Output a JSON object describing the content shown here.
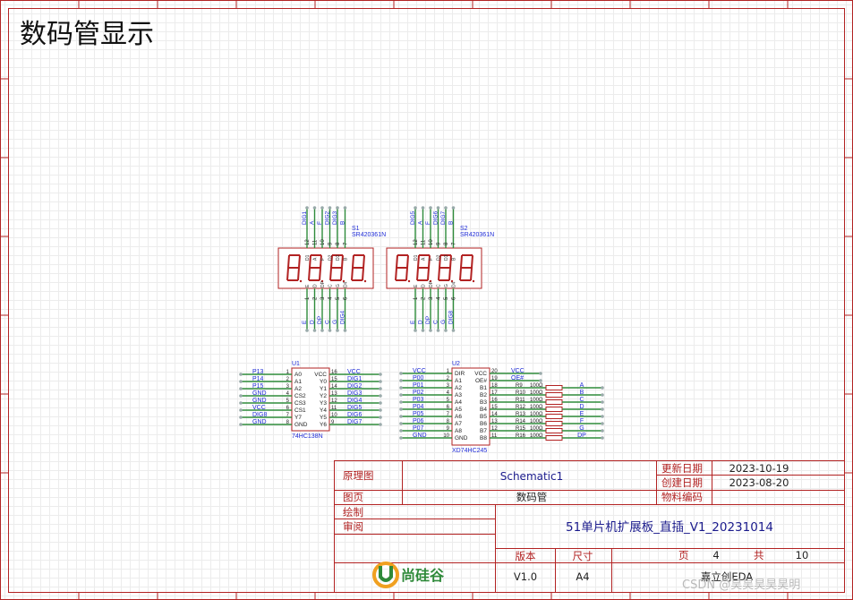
{
  "sheet": {
    "title": "数码管显示",
    "accent": "#b22222",
    "wire_color": "#2e8b3a",
    "text_color": "#1e2bd6"
  },
  "displays": [
    {
      "ref": "S1",
      "part": "SR420361N",
      "top_pins": [
        {
          "num": "12",
          "net": "DIG1",
          "inner": "D1"
        },
        {
          "num": "11",
          "net": "A",
          "inner": "A"
        },
        {
          "num": "10",
          "net": "F",
          "inner": "F"
        },
        {
          "num": "9",
          "net": "DIG2",
          "inner": "D2"
        },
        {
          "num": "8",
          "net": "DIG3",
          "inner": "D3"
        },
        {
          "num": "7",
          "net": "B",
          "inner": "B"
        }
      ],
      "bottom_pins": [
        {
          "num": "1",
          "net": "E",
          "inner": "E"
        },
        {
          "num": "2",
          "net": "D",
          "inner": "D"
        },
        {
          "num": "3",
          "net": "DP",
          "inner": "DP"
        },
        {
          "num": "4",
          "net": "C",
          "inner": "C"
        },
        {
          "num": "5",
          "net": "G",
          "inner": "G"
        },
        {
          "num": "6",
          "net": "DIG4",
          "inner": "D4"
        }
      ]
    },
    {
      "ref": "S2",
      "part": "SR420361N",
      "top_pins": [
        {
          "num": "12",
          "net": "DIG5",
          "inner": "D1"
        },
        {
          "num": "11",
          "net": "A",
          "inner": "A"
        },
        {
          "num": "10",
          "net": "F",
          "inner": "F"
        },
        {
          "num": "9",
          "net": "DIG6",
          "inner": "D2"
        },
        {
          "num": "8",
          "net": "DIG7",
          "inner": "D3"
        },
        {
          "num": "7",
          "net": "B",
          "inner": "B"
        }
      ],
      "bottom_pins": [
        {
          "num": "1",
          "net": "E",
          "inner": "E"
        },
        {
          "num": "2",
          "net": "D",
          "inner": "D"
        },
        {
          "num": "3",
          "net": "DP",
          "inner": "DP"
        },
        {
          "num": "4",
          "net": "C",
          "inner": "C"
        },
        {
          "num": "5",
          "net": "G",
          "inner": "G"
        },
        {
          "num": "6",
          "net": "DIG8",
          "inner": "D4"
        }
      ]
    }
  ],
  "u1": {
    "ref": "U1",
    "part": "74HC138N",
    "left": [
      {
        "net": "P13",
        "num": "1",
        "pin": "A0"
      },
      {
        "net": "P14",
        "num": "2",
        "pin": "A1"
      },
      {
        "net": "P15",
        "num": "3",
        "pin": "A2"
      },
      {
        "net": "GND",
        "num": "4",
        "pin": "CS2"
      },
      {
        "net": "GND",
        "num": "5",
        "pin": "CS3"
      },
      {
        "net": "VCC",
        "num": "6",
        "pin": "CS1"
      },
      {
        "net": "DIG8",
        "num": "7",
        "pin": "Y7"
      },
      {
        "net": "GND",
        "num": "8",
        "pin": "GND"
      }
    ],
    "right": [
      {
        "pin": "VCC",
        "num": "16",
        "net": "VCC"
      },
      {
        "pin": "Y0",
        "num": "15",
        "net": "DIG1"
      },
      {
        "pin": "Y1",
        "num": "14",
        "net": "DIG2"
      },
      {
        "pin": "Y2",
        "num": "13",
        "net": "DIG3"
      },
      {
        "pin": "Y3",
        "num": "12",
        "net": "DIG4"
      },
      {
        "pin": "Y4",
        "num": "11",
        "net": "DIG5"
      },
      {
        "pin": "Y5",
        "num": "10",
        "net": "DIG6"
      },
      {
        "pin": "Y6",
        "num": "9",
        "net": "DIG7"
      }
    ]
  },
  "u2": {
    "ref": "U2",
    "part": "XD74HC245",
    "left": [
      {
        "net": "VCC",
        "num": "1",
        "pin": "DIR"
      },
      {
        "net": "P00",
        "num": "2",
        "pin": "A1"
      },
      {
        "net": "P01",
        "num": "3",
        "pin": "A2"
      },
      {
        "net": "P02",
        "num": "4",
        "pin": "A3"
      },
      {
        "net": "P03",
        "num": "5",
        "pin": "A4"
      },
      {
        "net": "P04",
        "num": "6",
        "pin": "A5"
      },
      {
        "net": "P05",
        "num": "7",
        "pin": "A6"
      },
      {
        "net": "P06",
        "num": "8",
        "pin": "A7"
      },
      {
        "net": "P07",
        "num": "9",
        "pin": "A8"
      },
      {
        "net": "GND",
        "num": "10",
        "pin": "GND"
      }
    ],
    "right": [
      {
        "pin": "VCC",
        "num": "20",
        "net": "VCC"
      },
      {
        "pin": "OE#",
        "num": "19",
        "net": "OE#"
      },
      {
        "pin": "B1",
        "num": "18",
        "res": "R9",
        "val": "100Ω",
        "net": "A"
      },
      {
        "pin": "B2",
        "num": "17",
        "res": "R10",
        "val": "100Ω",
        "net": "B"
      },
      {
        "pin": "B3",
        "num": "16",
        "res": "R11",
        "val": "100Ω",
        "net": "C"
      },
      {
        "pin": "B4",
        "num": "15",
        "res": "R12",
        "val": "100Ω",
        "net": "D"
      },
      {
        "pin": "B5",
        "num": "14",
        "res": "R13",
        "val": "100Ω",
        "net": "E"
      },
      {
        "pin": "B6",
        "num": "13",
        "res": "R14",
        "val": "100Ω",
        "net": "F"
      },
      {
        "pin": "B7",
        "num": "12",
        "res": "R15",
        "val": "100Ω",
        "net": "G"
      },
      {
        "pin": "B8",
        "num": "11",
        "res": "R16",
        "val": "100Ω",
        "net": "DP"
      }
    ]
  },
  "title_block": {
    "schematic_label": "原理图",
    "schematic_value": "Schematic1",
    "page_label": "图页",
    "page_value": "数码管",
    "updated_label": "更新日期",
    "updated_value": "2023-10-19",
    "created_label": "创建日期",
    "created_value": "2023-08-20",
    "material_label": "物料编码",
    "drawn_label": "绘制",
    "review_label": "审阅",
    "project": "51单片机扩展板_直插_V1_20231014",
    "version_label": "版本",
    "size_label": "尺寸",
    "version_value": "V1.0",
    "size_value": "A4",
    "page_word": "页",
    "page_num": "4",
    "total_word": "共",
    "total_num": "10",
    "company": "嘉立创EDA",
    "logo_text": "尚硅谷"
  },
  "watermark": "CSDN @昊昊昊昊昊明"
}
